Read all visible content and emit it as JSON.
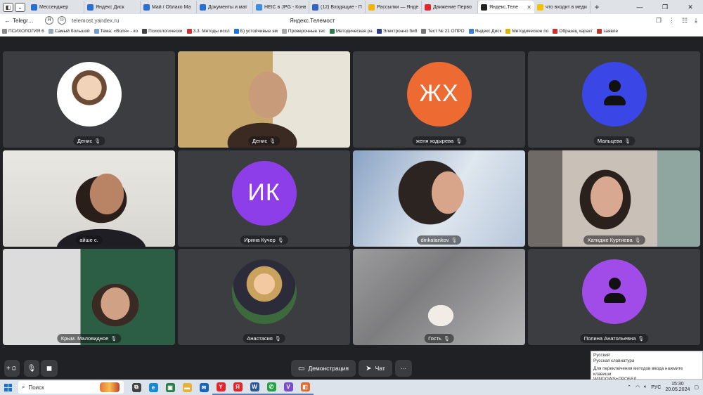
{
  "browser": {
    "tabs": [
      {
        "title": "Мессенджер",
        "color": "#2a6fd6"
      },
      {
        "title": "Яндекс Диск",
        "color": "#2a6fd6"
      },
      {
        "title": "Май / Облако Ма",
        "color": "#2a6fd6"
      },
      {
        "title": "Документы и мат",
        "color": "#2a6fd6"
      },
      {
        "title": "HEIC в JPG - Конв",
        "color": "#3a8de0"
      },
      {
        "title": "(12) Входящие - П",
        "color": "#3361c4"
      },
      {
        "title": "Рассылки — Янде",
        "color": "#f2b400"
      },
      {
        "title": "Движение Перво",
        "color": "#e4262c"
      },
      {
        "title": "Яндекс.Теле",
        "color": "#222222"
      },
      {
        "title": "что входит в меди",
        "color": "#f6c000"
      }
    ],
    "active_tab_index": 8,
    "new_tab_symbol": "+",
    "window_controls": [
      "—",
      "❐",
      "✕"
    ],
    "back_label": "Telegr…",
    "url": "telemost.yandex.ru",
    "page_title": "Яндекс.Телемост",
    "bookmarks": [
      {
        "label": "ПСИХОЛОГИЯ 6",
        "color": "#8a8a8a"
      },
      {
        "label": "Самый большой",
        "color": "#9aa9b8"
      },
      {
        "label": "Тема: «Воля» - ко",
        "color": "#7a9cc8"
      },
      {
        "label": "Психологически",
        "color": "#444444"
      },
      {
        "label": "3.3. Методы иссл",
        "color": "#d0303a"
      },
      {
        "label": "Б) устойчивые эм",
        "color": "#1a73e8"
      },
      {
        "label": "Проверочные тес",
        "color": "#a9a9a9"
      },
      {
        "label": "Методическая ра",
        "color": "#2e7d4f"
      },
      {
        "label": "Электронно биб",
        "color": "#2c3e8c"
      },
      {
        "label": "Тест № 21 ОПРО",
        "color": "#777777"
      },
      {
        "label": "Яндекс.Диск",
        "color": "#3c7bd9"
      },
      {
        "label": "Методическое по",
        "color": "#e0b400"
      },
      {
        "label": "Образец характ",
        "color": "#d03030"
      },
      {
        "label": "заявле",
        "color": "#c0392b"
      }
    ]
  },
  "participants": [
    {
      "name": "Денис",
      "kind": "photo"
    },
    {
      "name": "Денис",
      "kind": "video"
    },
    {
      "name": "женя ходырева",
      "kind": "initials",
      "initials": "ЖХ",
      "color": "#ee6a33"
    },
    {
      "name": "Мальцева",
      "kind": "icon",
      "color": "#3b46e6"
    },
    {
      "name": "айше с.",
      "kind": "video",
      "speaking": true
    },
    {
      "name": "Ирина Кучер",
      "kind": "initials",
      "initials": "ИК",
      "color": "#8e3ee8"
    },
    {
      "name": "dinkatankov",
      "kind": "video"
    },
    {
      "name": "Хатидже Куртиева",
      "kind": "video"
    },
    {
      "name": "Крым. Маловидное",
      "kind": "video"
    },
    {
      "name": "Анастасия",
      "kind": "photo"
    },
    {
      "name": "Гость",
      "kind": "video"
    },
    {
      "name": "Полина Анатольевна",
      "kind": "icon",
      "color": "#a14be8"
    }
  ],
  "controls": {
    "demo_label": "Демонстрация",
    "chat_label": "Чат",
    "more_label": "···"
  },
  "language_tooltip": {
    "line1": "Русский",
    "line2": "Русская клавиатура",
    "line3": "Для переключения методов ввода нажмите клавиши",
    "line4": "WINDOWS+ПРОБЕЛ."
  },
  "taskbar": {
    "search_label": "Поиск",
    "apps": [
      {
        "icon": "task-view-icon",
        "color": "#444444",
        "glyph": "⧉"
      },
      {
        "icon": "edge-icon",
        "color": "#1a8ad0",
        "glyph": "e"
      },
      {
        "icon": "store-icon",
        "color": "#2d7d46",
        "glyph": "▣"
      },
      {
        "icon": "explorer-icon",
        "color": "#e8b23a",
        "glyph": "▬"
      },
      {
        "icon": "mail-icon",
        "color": "#1565c0",
        "glyph": "✉"
      },
      {
        "icon": "yandex-browser-icon",
        "color": "#e4262c",
        "glyph": "Y"
      },
      {
        "icon": "yandex-icon",
        "color": "#e4262c",
        "glyph": "Я"
      },
      {
        "icon": "word-icon",
        "color": "#2b579a",
        "glyph": "W"
      },
      {
        "icon": "whatsapp-icon",
        "color": "#25a244",
        "glyph": "✆"
      },
      {
        "icon": "viber-icon",
        "color": "#7a4fc9",
        "glyph": "V"
      },
      {
        "icon": "telemost-icon",
        "color": "#e06a2c",
        "glyph": "◧"
      }
    ],
    "language": "РУС",
    "time": "15:30",
    "date": "20.05.2024"
  }
}
